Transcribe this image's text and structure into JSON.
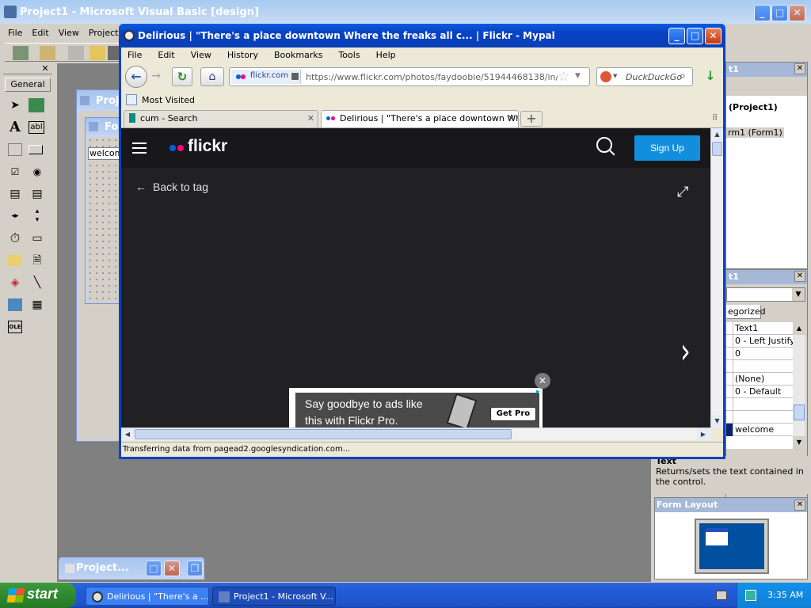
{
  "vb": {
    "title": "Project1 - Microsoft Visual Basic [design]",
    "menu": [
      "File",
      "Edit",
      "View",
      "Project",
      "Fo"
    ],
    "toolbox_tab": "General",
    "project_window_title": "Proje",
    "form_title": "Fo",
    "form_text": "welcom",
    "project_explorer": {
      "title": "t1",
      "root": "(Project1)",
      "child": "rm1 (Form1)"
    },
    "properties": {
      "title": "t1",
      "tab": "egorized",
      "rows": [
        "Text1",
        "0 - Left Justify",
        "0",
        "",
        "(None)",
        "0 - Default",
        "",
        "",
        "welcome"
      ],
      "desc_title": "Text",
      "desc_text": "Returns/sets the text contained in the control."
    },
    "form_layout_title": "Form Layout",
    "minimized_title": "Project..."
  },
  "browser": {
    "title": "Delirious | \"There's a place downtown Where the freaks all c... | Flickr - Mypal",
    "menu": [
      "File",
      "Edit",
      "View",
      "History",
      "Bookmarks",
      "Tools",
      "Help"
    ],
    "domain_badge": "flickr.com",
    "url": "https://www.flickr.com/photos/faydoobie/51944468138/in/photol",
    "search_placeholder": "DuckDuckGo",
    "bookmark": "Most Visited",
    "tabs": [
      {
        "label": "cum - Search",
        "active": false
      },
      {
        "label": "Delirious | \"There's a place downtown Wh...",
        "active": true
      }
    ],
    "status": "Transferring data from pagead2.googlesyndication.com..."
  },
  "flickr": {
    "logo": "flickr",
    "signup": "Sign Up",
    "back": "Back to tag",
    "ad_line1": "Say goodbye to ads like",
    "ad_line2": "this with Flickr Pro.",
    "ad_button": "Get Pro"
  },
  "taskbar": {
    "start": "start",
    "items": [
      "Delirious | \"There's a ...",
      "Project1 - Microsoft V..."
    ],
    "clock": "3:35 AM"
  },
  "colors": {
    "flickr_blue": "#0063dc",
    "flickr_pink": "#ff0084",
    "flickr_bg": "#212124",
    "xp_blue": "#0842c4"
  }
}
